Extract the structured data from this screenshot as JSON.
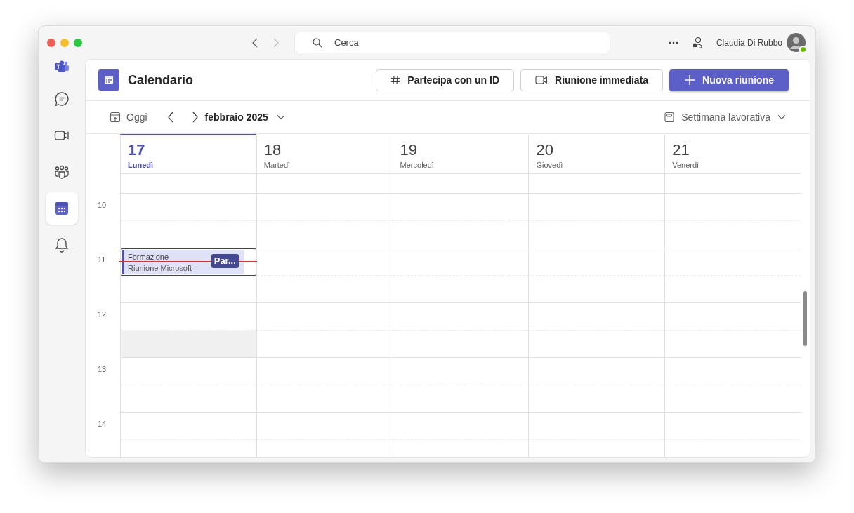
{
  "title_bar": {
    "search": {
      "placeholder": "Cerca"
    },
    "user_name": "Claudia Di Rubbo"
  },
  "sidebar": [
    {
      "kind": "logo",
      "selected": false
    },
    {
      "kind": "chat",
      "selected": false
    },
    {
      "kind": "video",
      "selected": false
    },
    {
      "kind": "people",
      "selected": false
    },
    {
      "kind": "calendar",
      "selected": true
    },
    {
      "kind": "bell",
      "selected": false
    }
  ],
  "header": {
    "title": "Calendario",
    "buttons": [
      {
        "label": "Partecipa con un ID",
        "kind": "join"
      },
      {
        "label": "Riunione immediata",
        "kind": "meet"
      },
      {
        "label": "Nuova riunione",
        "kind": "new"
      }
    ]
  },
  "toolbar": {
    "today": "Oggi",
    "month": "febbraio 2025",
    "view": "Settimana lavorativa"
  },
  "hours": [
    "10",
    "11",
    "12",
    "13",
    "14"
  ],
  "days": [
    {
      "number": "17",
      "name": "Lunedì",
      "selected": true,
      "now_line": true,
      "highlighted_slot": true,
      "events": [
        {
          "title": "Formazione",
          "subtitle": "Riunione Microsoft",
          "action": "Par...",
          "selected": true
        }
      ]
    },
    {
      "number": "18",
      "name": "Martedì",
      "selected": false,
      "now_line": false,
      "highlighted_slot": false
    },
    {
      "number": "19",
      "name": "Mercoledì",
      "selected": false,
      "now_line": false,
      "highlighted_slot": false
    },
    {
      "number": "20",
      "name": "Giovedì",
      "selected": false,
      "now_line": false,
      "highlighted_slot": false
    },
    {
      "number": "21",
      "name": "Venerdì",
      "selected": false,
      "now_line": false,
      "highlighted_slot": false
    }
  ]
}
